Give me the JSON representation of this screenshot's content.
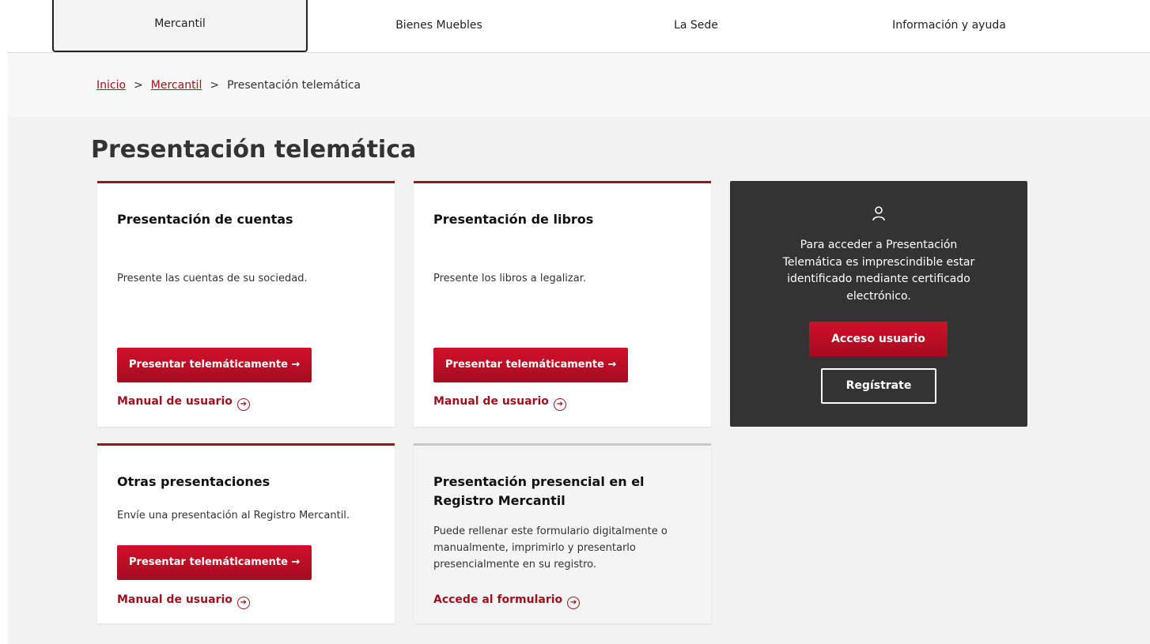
{
  "nav": {
    "tabs": [
      {
        "label": "Mercantil"
      },
      {
        "label": "Bienes Muebles"
      },
      {
        "label": "La Sede"
      },
      {
        "label": "Información y ayuda"
      }
    ]
  },
  "breadcrumb": {
    "home": "Inicio",
    "section": "Mercantil",
    "current": "Presentación telemática",
    "separator": ">"
  },
  "page": {
    "title": "Presentación telemática"
  },
  "cards": [
    {
      "title": "Presentación de cuentas",
      "description": "Presente las cuentas de su sociedad.",
      "button": "Presentar telemáticamente →",
      "link": "Manual de usuario"
    },
    {
      "title": "Presentación de libros",
      "description": "Presente los libros a legalizar.",
      "button": "Presentar telemáticamente →",
      "link": "Manual de usuario"
    },
    {
      "title": "Otras presentaciones",
      "description": "Envíe una presentación al Registro Mercantil.",
      "button": "Presentar telemáticamente →",
      "link": "Manual de usuario"
    },
    {
      "title_line1": "Presentación presencial en el",
      "title_line2": "Registro Mercantil",
      "description": "Puede rellenar este formulario digitalmente o manualmente, imprimirlo y presentarlo presencialmente en su registro.",
      "link": "Accede al formulario"
    }
  ],
  "login_panel": {
    "message": "Para acceder a Presentación Telemática es imprescindible estar identificado mediante certificado electrónico.",
    "access_button": "Acceso usuario",
    "register_button": "Regístrate"
  },
  "colors": {
    "accent": "#a0111f",
    "button": "#c20f26",
    "panel": "#333333",
    "background": "#f2f2f2"
  },
  "icons": {
    "arrow": "→",
    "circle_arrow": "➔"
  }
}
